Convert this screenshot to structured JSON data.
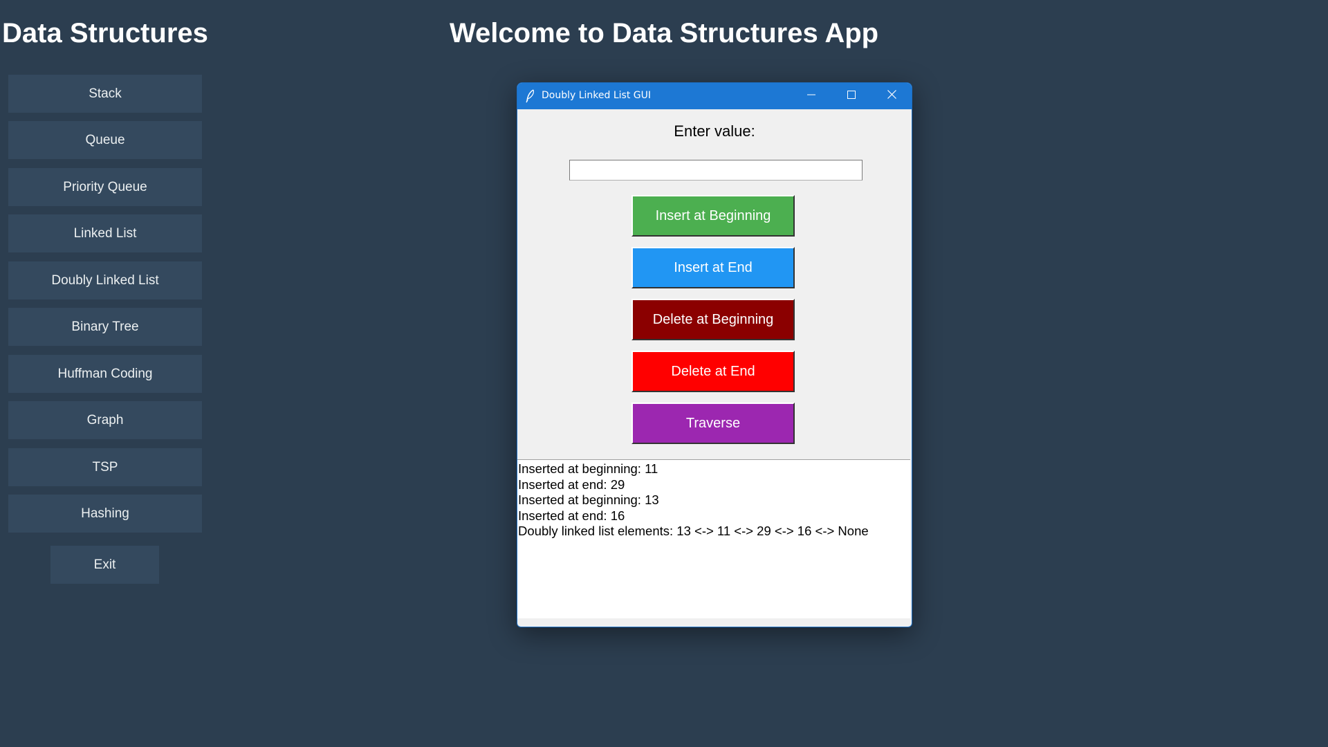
{
  "app": {
    "sidebar_title": "Data Structures",
    "main_title": "Welcome to Data Structures App"
  },
  "sidebar": {
    "items": [
      {
        "label": "Stack"
      },
      {
        "label": "Queue"
      },
      {
        "label": "Priority Queue"
      },
      {
        "label": "Linked List"
      },
      {
        "label": "Doubly Linked List"
      },
      {
        "label": "Binary Tree"
      },
      {
        "label": "Huffman Coding"
      },
      {
        "label": "Graph"
      },
      {
        "label": "TSP"
      },
      {
        "label": "Hashing"
      }
    ],
    "exit_label": "Exit"
  },
  "dialog": {
    "title": "Doubly Linked List GUI",
    "icon": "feather-icon",
    "controls": {
      "minimize": "minimize-icon",
      "maximize": "maximize-icon",
      "close": "close-icon"
    },
    "prompt_label": "Enter value:",
    "input_value": "",
    "buttons": {
      "insert_beginning": "Insert at Beginning",
      "insert_end": "Insert at End",
      "delete_beginning": "Delete at Beginning",
      "delete_end": "Delete at End",
      "traverse": "Traverse"
    },
    "output_lines": [
      "Inserted at beginning: 11",
      "Inserted at end: 29",
      "Inserted at beginning: 13",
      "Inserted at end: 16",
      "Doubly linked list elements: 13 <-> 11 <-> 29 <-> 16 <-> None"
    ]
  },
  "colors": {
    "background": "#2c3e50",
    "sidebar_button": "#34495e",
    "titlebar": "#1d78d4",
    "insert_beginning": "#4caf50",
    "insert_end": "#2196f3",
    "delete_beginning": "#8b0000",
    "delete_end": "#ff0000",
    "traverse": "#9c27b0"
  }
}
